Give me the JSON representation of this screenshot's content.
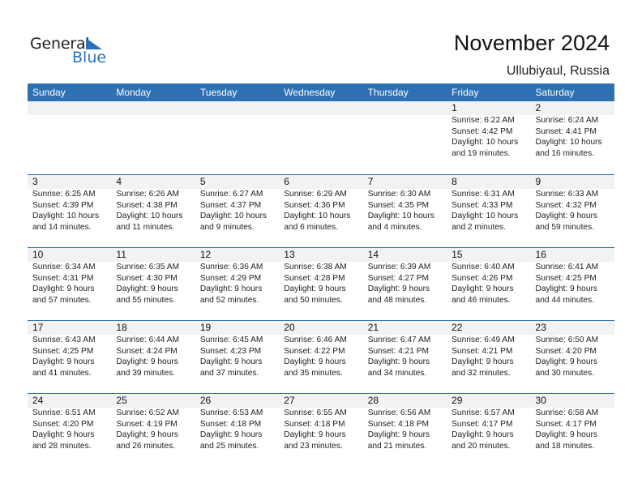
{
  "logo": {
    "general": "General",
    "blue": "Blue"
  },
  "header": {
    "title": "November 2024",
    "location": "Ullubiyaul, Russia"
  },
  "colors": {
    "accent": "#2e71b2",
    "strip": "#f2f2f2",
    "logo_blue": "#2a72b8"
  },
  "weekdays": [
    "Sunday",
    "Monday",
    "Tuesday",
    "Wednesday",
    "Thursday",
    "Friday",
    "Saturday"
  ],
  "weeks": [
    [
      null,
      null,
      null,
      null,
      null,
      {
        "day": "1",
        "sunrise": "Sunrise: 6:22 AM",
        "sunset": "Sunset: 4:42 PM",
        "daylight1": "Daylight: 10 hours",
        "daylight2": "and 19 minutes."
      },
      {
        "day": "2",
        "sunrise": "Sunrise: 6:24 AM",
        "sunset": "Sunset: 4:41 PM",
        "daylight1": "Daylight: 10 hours",
        "daylight2": "and 16 minutes."
      }
    ],
    [
      {
        "day": "3",
        "sunrise": "Sunrise: 6:25 AM",
        "sunset": "Sunset: 4:39 PM",
        "daylight1": "Daylight: 10 hours",
        "daylight2": "and 14 minutes."
      },
      {
        "day": "4",
        "sunrise": "Sunrise: 6:26 AM",
        "sunset": "Sunset: 4:38 PM",
        "daylight1": "Daylight: 10 hours",
        "daylight2": "and 11 minutes."
      },
      {
        "day": "5",
        "sunrise": "Sunrise: 6:27 AM",
        "sunset": "Sunset: 4:37 PM",
        "daylight1": "Daylight: 10 hours",
        "daylight2": "and 9 minutes."
      },
      {
        "day": "6",
        "sunrise": "Sunrise: 6:29 AM",
        "sunset": "Sunset: 4:36 PM",
        "daylight1": "Daylight: 10 hours",
        "daylight2": "and 6 minutes."
      },
      {
        "day": "7",
        "sunrise": "Sunrise: 6:30 AM",
        "sunset": "Sunset: 4:35 PM",
        "daylight1": "Daylight: 10 hours",
        "daylight2": "and 4 minutes."
      },
      {
        "day": "8",
        "sunrise": "Sunrise: 6:31 AM",
        "sunset": "Sunset: 4:33 PM",
        "daylight1": "Daylight: 10 hours",
        "daylight2": "and 2 minutes."
      },
      {
        "day": "9",
        "sunrise": "Sunrise: 6:33 AM",
        "sunset": "Sunset: 4:32 PM",
        "daylight1": "Daylight: 9 hours",
        "daylight2": "and 59 minutes."
      }
    ],
    [
      {
        "day": "10",
        "sunrise": "Sunrise: 6:34 AM",
        "sunset": "Sunset: 4:31 PM",
        "daylight1": "Daylight: 9 hours",
        "daylight2": "and 57 minutes."
      },
      {
        "day": "11",
        "sunrise": "Sunrise: 6:35 AM",
        "sunset": "Sunset: 4:30 PM",
        "daylight1": "Daylight: 9 hours",
        "daylight2": "and 55 minutes."
      },
      {
        "day": "12",
        "sunrise": "Sunrise: 6:36 AM",
        "sunset": "Sunset: 4:29 PM",
        "daylight1": "Daylight: 9 hours",
        "daylight2": "and 52 minutes."
      },
      {
        "day": "13",
        "sunrise": "Sunrise: 6:38 AM",
        "sunset": "Sunset: 4:28 PM",
        "daylight1": "Daylight: 9 hours",
        "daylight2": "and 50 minutes."
      },
      {
        "day": "14",
        "sunrise": "Sunrise: 6:39 AM",
        "sunset": "Sunset: 4:27 PM",
        "daylight1": "Daylight: 9 hours",
        "daylight2": "and 48 minutes."
      },
      {
        "day": "15",
        "sunrise": "Sunrise: 6:40 AM",
        "sunset": "Sunset: 4:26 PM",
        "daylight1": "Daylight: 9 hours",
        "daylight2": "and 46 minutes."
      },
      {
        "day": "16",
        "sunrise": "Sunrise: 6:41 AM",
        "sunset": "Sunset: 4:25 PM",
        "daylight1": "Daylight: 9 hours",
        "daylight2": "and 44 minutes."
      }
    ],
    [
      {
        "day": "17",
        "sunrise": "Sunrise: 6:43 AM",
        "sunset": "Sunset: 4:25 PM",
        "daylight1": "Daylight: 9 hours",
        "daylight2": "and 41 minutes."
      },
      {
        "day": "18",
        "sunrise": "Sunrise: 6:44 AM",
        "sunset": "Sunset: 4:24 PM",
        "daylight1": "Daylight: 9 hours",
        "daylight2": "and 39 minutes."
      },
      {
        "day": "19",
        "sunrise": "Sunrise: 6:45 AM",
        "sunset": "Sunset: 4:23 PM",
        "daylight1": "Daylight: 9 hours",
        "daylight2": "and 37 minutes."
      },
      {
        "day": "20",
        "sunrise": "Sunrise: 6:46 AM",
        "sunset": "Sunset: 4:22 PM",
        "daylight1": "Daylight: 9 hours",
        "daylight2": "and 35 minutes."
      },
      {
        "day": "21",
        "sunrise": "Sunrise: 6:47 AM",
        "sunset": "Sunset: 4:21 PM",
        "daylight1": "Daylight: 9 hours",
        "daylight2": "and 34 minutes."
      },
      {
        "day": "22",
        "sunrise": "Sunrise: 6:49 AM",
        "sunset": "Sunset: 4:21 PM",
        "daylight1": "Daylight: 9 hours",
        "daylight2": "and 32 minutes."
      },
      {
        "day": "23",
        "sunrise": "Sunrise: 6:50 AM",
        "sunset": "Sunset: 4:20 PM",
        "daylight1": "Daylight: 9 hours",
        "daylight2": "and 30 minutes."
      }
    ],
    [
      {
        "day": "24",
        "sunrise": "Sunrise: 6:51 AM",
        "sunset": "Sunset: 4:20 PM",
        "daylight1": "Daylight: 9 hours",
        "daylight2": "and 28 minutes."
      },
      {
        "day": "25",
        "sunrise": "Sunrise: 6:52 AM",
        "sunset": "Sunset: 4:19 PM",
        "daylight1": "Daylight: 9 hours",
        "daylight2": "and 26 minutes."
      },
      {
        "day": "26",
        "sunrise": "Sunrise: 6:53 AM",
        "sunset": "Sunset: 4:18 PM",
        "daylight1": "Daylight: 9 hours",
        "daylight2": "and 25 minutes."
      },
      {
        "day": "27",
        "sunrise": "Sunrise: 6:55 AM",
        "sunset": "Sunset: 4:18 PM",
        "daylight1": "Daylight: 9 hours",
        "daylight2": "and 23 minutes."
      },
      {
        "day": "28",
        "sunrise": "Sunrise: 6:56 AM",
        "sunset": "Sunset: 4:18 PM",
        "daylight1": "Daylight: 9 hours",
        "daylight2": "and 21 minutes."
      },
      {
        "day": "29",
        "sunrise": "Sunrise: 6:57 AM",
        "sunset": "Sunset: 4:17 PM",
        "daylight1": "Daylight: 9 hours",
        "daylight2": "and 20 minutes."
      },
      {
        "day": "30",
        "sunrise": "Sunrise: 6:58 AM",
        "sunset": "Sunset: 4:17 PM",
        "daylight1": "Daylight: 9 hours",
        "daylight2": "and 18 minutes."
      }
    ]
  ]
}
